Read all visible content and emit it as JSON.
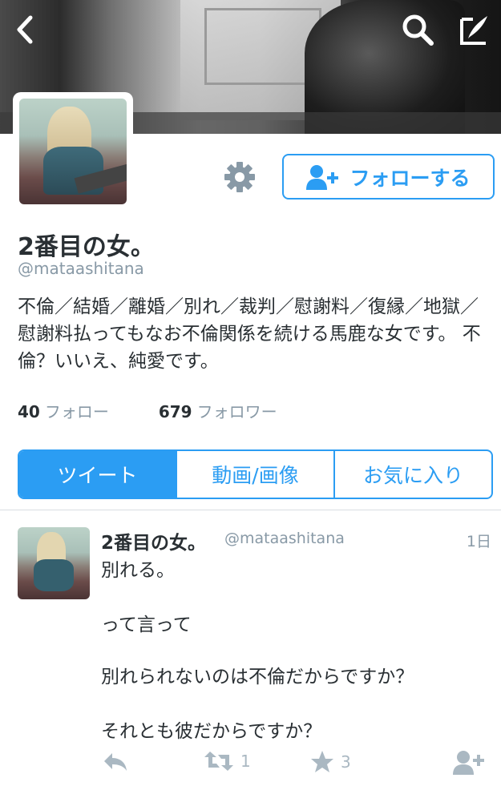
{
  "colors": {
    "accent": "#2b9df3",
    "muted": "#8899a6",
    "icon_gray": "#aab8c2"
  },
  "profile": {
    "name": "2番目の女。",
    "handle": "@mataashitana",
    "bio": "不倫／結婚／離婚／別れ／裁判／慰謝料／復縁／地獄／慰謝料払ってもなお不倫関係を続ける馬鹿な女です。 不倫？いいえ、純愛です。",
    "follow_label": "フォローする"
  },
  "stats": {
    "following_count": "40",
    "following_label": "フォロー",
    "followers_count": "679",
    "followers_label": "フォロワー"
  },
  "tabs": [
    {
      "label": "ツイート",
      "active": true
    },
    {
      "label": "動画/画像",
      "active": false
    },
    {
      "label": "お気に入り",
      "active": false
    }
  ],
  "tweet": {
    "name": "2番目の女。",
    "handle": "@mataashitana",
    "time": "1日",
    "lines": [
      "別れる。",
      "って言って",
      "別れられないのは不倫だからですか？",
      "それとも彼だからですか？"
    ],
    "retweet_count": "1",
    "favorite_count": "3"
  },
  "icons": [
    "back-icon",
    "search-icon",
    "compose-icon",
    "gear-icon",
    "add-user-icon",
    "reply-icon",
    "retweet-icon",
    "star-icon",
    "follow-icon"
  ]
}
